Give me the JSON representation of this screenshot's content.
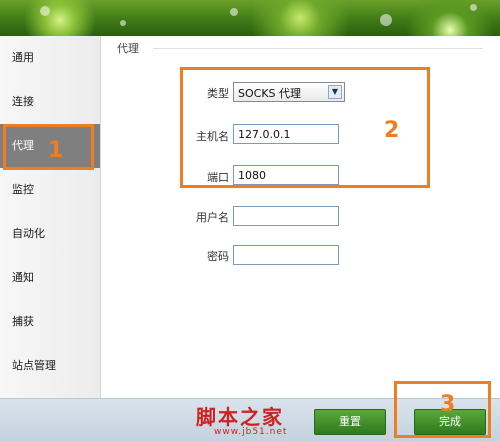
{
  "sidebar": {
    "items": [
      {
        "label": "通用"
      },
      {
        "label": "连接"
      },
      {
        "label": "代理"
      },
      {
        "label": "监控"
      },
      {
        "label": "自动化"
      },
      {
        "label": "通知"
      },
      {
        "label": "捕获"
      },
      {
        "label": "站点管理"
      }
    ],
    "active_index": 2
  },
  "proxy": {
    "section_title": "代理",
    "type_label": "类型",
    "type_value": "SOCKS 代理",
    "host_label": "主机名",
    "host_value": "127.0.0.1",
    "port_label": "端口",
    "port_value": "1080",
    "user_label": "用户名",
    "user_value": "",
    "password_label": "密码",
    "password_value": ""
  },
  "footer": {
    "reset_label": "重置",
    "done_label": "完成"
  },
  "annotations": {
    "one": "1",
    "two": "2",
    "three": "3",
    "color": "#ef7d22"
  },
  "watermark": {
    "title": "脚本之家",
    "url": "www.jb51.net"
  },
  "colors": {
    "accent_green": "#3f8a26",
    "active_nav": "#7f7f7f"
  }
}
